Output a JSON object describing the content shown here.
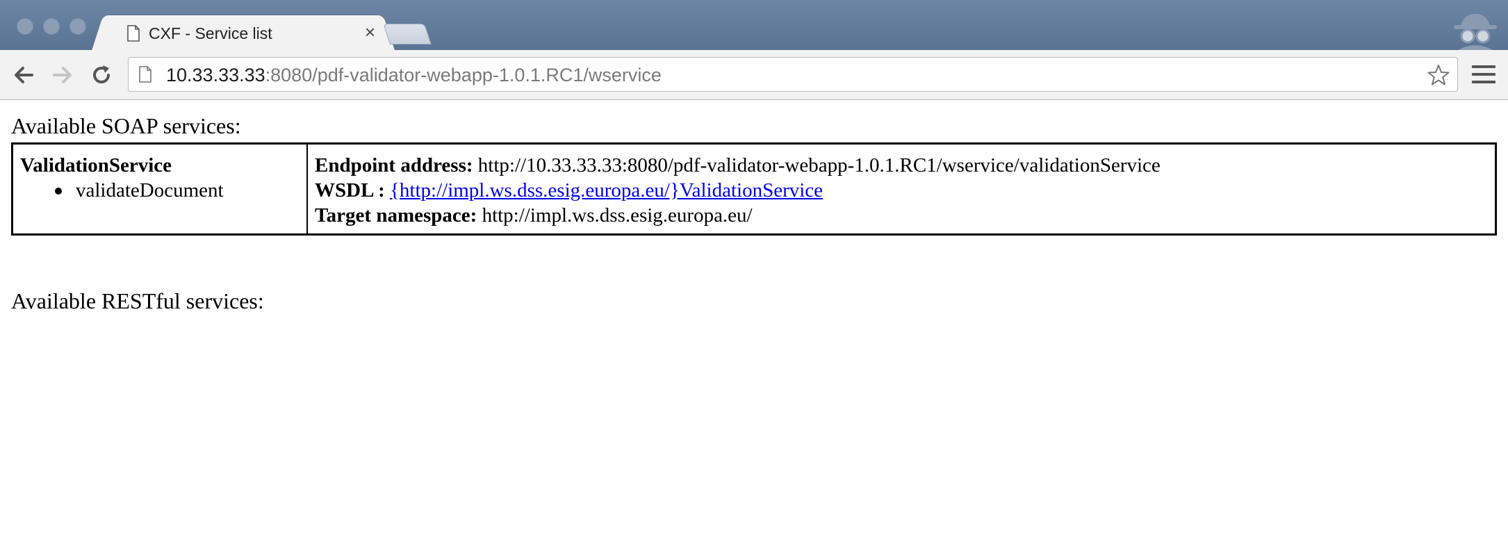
{
  "browser": {
    "tab": {
      "title": "CXF - Service list",
      "close_glyph": "×"
    },
    "address_bar": {
      "host": "10.33.33.33",
      "rest": ":8080/pdf-validator-webapp-1.0.1.RC1/wservice"
    },
    "icons": {
      "window_buttons": [
        "close-dot",
        "minimize-dot",
        "zoom-dot"
      ],
      "nav": [
        "back-arrow-icon",
        "forward-arrow-icon",
        "reload-icon"
      ],
      "bookmark": "star-icon",
      "menu": "hamburger-menu-icon",
      "profile": "incognito-icon"
    },
    "colors": {
      "titlebar": "#5a7394",
      "toolbar": "#f2f2f2",
      "link": "#0000ee"
    }
  },
  "page": {
    "soap_heading": "Available SOAP services:",
    "services": [
      {
        "name": "ValidationService",
        "operations": [
          "validateDocument"
        ],
        "endpoint_label": "Endpoint address:",
        "endpoint": "http://10.33.33.33:8080/pdf-validator-webapp-1.0.1.RC1/wservice/validationService",
        "wsdl_label": "WSDL :",
        "wsdl_link": "{http://impl.ws.dss.esig.europa.eu/}ValidationService",
        "namespace_label": "Target namespace:",
        "namespace": "http://impl.ws.dss.esig.europa.eu/"
      }
    ],
    "rest_heading": "Available RESTful services:"
  }
}
